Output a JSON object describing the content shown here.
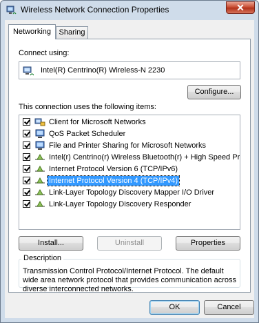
{
  "window": {
    "title": "Wireless Network Connection Properties",
    "close_glyph": "✕"
  },
  "tabs": [
    {
      "label": "Networking",
      "active": true
    },
    {
      "label": "Sharing",
      "active": false
    }
  ],
  "connect_using": {
    "label": "Connect using:",
    "adapter": "Intel(R) Centrino(R) Wireless-N 2230",
    "adapter_icon": "network-adapter-icon",
    "configure_label": "Configure..."
  },
  "items": {
    "label": "This connection uses the following items:",
    "list": [
      {
        "label": "Client for Microsoft Networks",
        "checked": true,
        "icon": "network-client-icon",
        "selected": false
      },
      {
        "label": "QoS Packet Scheduler",
        "checked": true,
        "icon": "network-service-icon",
        "selected": false
      },
      {
        "label": "File and Printer Sharing for Microsoft Networks",
        "checked": true,
        "icon": "network-service-icon",
        "selected": false
      },
      {
        "label": "Intel(r) Centrino(r) Wireless Bluetooth(r) + High Speed Pr...",
        "checked": true,
        "icon": "protocol-icon",
        "selected": false
      },
      {
        "label": "Internet Protocol Version 6 (TCP/IPv6)",
        "checked": true,
        "icon": "protocol-icon",
        "selected": false
      },
      {
        "label": "Internet Protocol Version 4 (TCP/IPv4)",
        "checked": true,
        "icon": "protocol-icon",
        "selected": true
      },
      {
        "label": "Link-Layer Topology Discovery Mapper I/O Driver",
        "checked": true,
        "icon": "protocol-icon",
        "selected": false
      },
      {
        "label": "Link-Layer Topology Discovery Responder",
        "checked": true,
        "icon": "protocol-icon",
        "selected": false
      }
    ]
  },
  "buttons": {
    "install": "Install...",
    "uninstall": "Uninstall",
    "properties": "Properties",
    "ok": "OK",
    "cancel": "Cancel"
  },
  "description": {
    "title": "Description",
    "text": "Transmission Control Protocol/Internet Protocol. The default wide area network protocol that provides communication across diverse interconnected networks."
  },
  "colors": {
    "selection": "#3399ff",
    "close": "#c74a30"
  }
}
